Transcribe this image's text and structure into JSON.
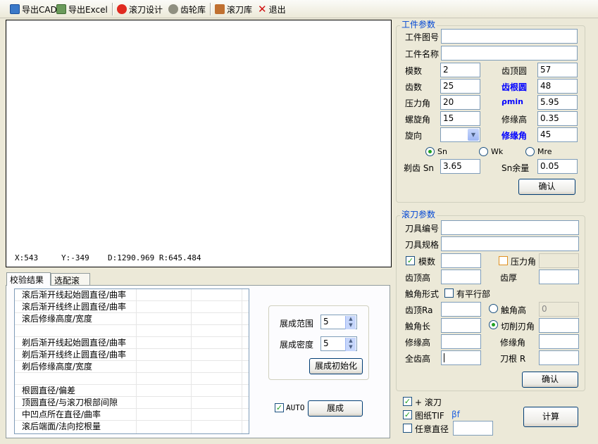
{
  "toolbar": {
    "export_cad": "导出CAD",
    "export_excel": "导出Excel",
    "hob_design": "滚刀设计",
    "gear_lib": "齿轮库",
    "hob_lib": "滚刀库",
    "exit": "退出"
  },
  "canvas": {
    "x": "X:543",
    "y": "Y:-349",
    "d": "D:1290.969 R:645.484"
  },
  "tabs": [
    "校验结果",
    "选配滚刀"
  ],
  "results": {
    "rows": [
      "滚后渐开线起始圆直径/曲率",
      "滚后渐开线终止圆直径/曲率",
      "滚后修缘高度/宽度",
      "",
      "剃后渐开线起始圆直径/曲率",
      "剃后渐开线终止圆直径/曲率",
      "剃后修缘高度/宽度",
      "",
      "根圆直径/偏差",
      "顶圆直径/与滚刀根部间隙",
      "中凹点所在直径/曲率",
      "滚后端面/法向挖根量"
    ]
  },
  "expand": {
    "range_label": "展成范围",
    "range_value": "5",
    "density_label": "展成密度",
    "density_value": "5",
    "init_button": "展成初始化",
    "auto_label": "AUTO",
    "expand_button": "展成"
  },
  "workpiece": {
    "title": "工件参数",
    "drawing_no_label": "工件图号",
    "drawing_no": "",
    "name_label": "工件名称",
    "name": "",
    "module_label": "模数",
    "module": "2",
    "tip_circle_label": "齿顶圆",
    "tip_circle": "57",
    "teeth_label": "齿数",
    "teeth": "25",
    "root_circle_label": "齿根圆",
    "root_circle": "48",
    "pressure_label": "压力角",
    "pressure": "20",
    "rho_label": "ρmin",
    "rho": "5.95",
    "helix_label": "螺旋角",
    "helix": "15",
    "edge_height_label": "修缘高",
    "edge_height": "0.35",
    "hand_label": "旋向",
    "hand": "",
    "edge_angle_label": "修缘角",
    "edge_angle": "45",
    "radio_sn": "Sn",
    "radio_wk": "Wk",
    "radio_mre": "Mre",
    "shave_label": "剃齿 Sn",
    "shave": "3.65",
    "allowance_label": "Sn余量",
    "allowance": "0.05",
    "ok_button": "确认"
  },
  "hob": {
    "title": "滚刀参数",
    "tool_no_label": "刀具编号",
    "tool_no": "",
    "tool_spec_label": "刀具规格",
    "tool_spec": "",
    "module_label": "模数",
    "module": "",
    "pressure_label": "压力角",
    "pressure": "",
    "tip_height_label": "齿顶高",
    "tip_height": "",
    "thickness_label": "齿厚",
    "thickness": "",
    "contact_label": "触角形式",
    "parallel_label": "有平行部",
    "tip_ra_label": "齿顶Ra",
    "tip_ra": "",
    "contact_height_label": "触角高",
    "contact_height": "0",
    "contact_len_label": "触角长",
    "contact_len": "",
    "cut_angle_label": "切削刃角",
    "cut_angle": "",
    "edge_height_label": "修缘高",
    "edge_height": "",
    "edge_angle_label": "修缘角",
    "edge_angle": "",
    "full_height_label": "全齿高",
    "full_height": "",
    "root_r_label": "刀根 R",
    "root_r": "",
    "ok_button": "确认"
  },
  "bottom": {
    "plus_hob": "+ 滚刀",
    "drawing_tif": "图纸TIF",
    "beta_f": "βf",
    "any_diameter": "任意直径",
    "any_diameter_value": "",
    "calc_button": "计算"
  }
}
